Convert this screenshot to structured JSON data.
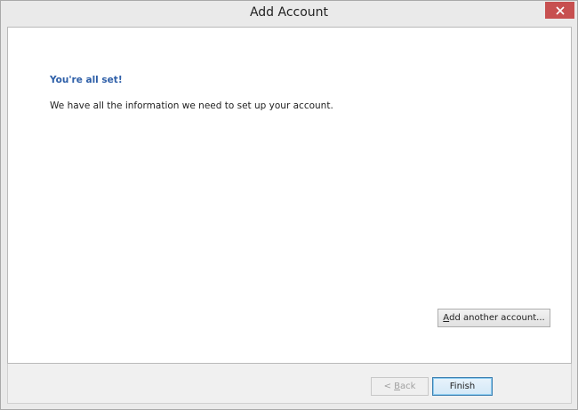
{
  "window": {
    "title": "Add Account"
  },
  "content": {
    "heading": "You're all set!",
    "message": "We have all the information we need to set up your account.",
    "add_another": {
      "label_accel": "A",
      "label_rest": "dd another account..."
    }
  },
  "footer": {
    "back": {
      "prefix": "< ",
      "accel": "B",
      "rest": "ack",
      "enabled": false
    },
    "finish_label": "Finish"
  },
  "colors": {
    "close_button": "#c75050",
    "heading": "#2e5fa8",
    "default_button_border": "#3c7fb1"
  },
  "icons": {
    "close": "close-icon"
  }
}
